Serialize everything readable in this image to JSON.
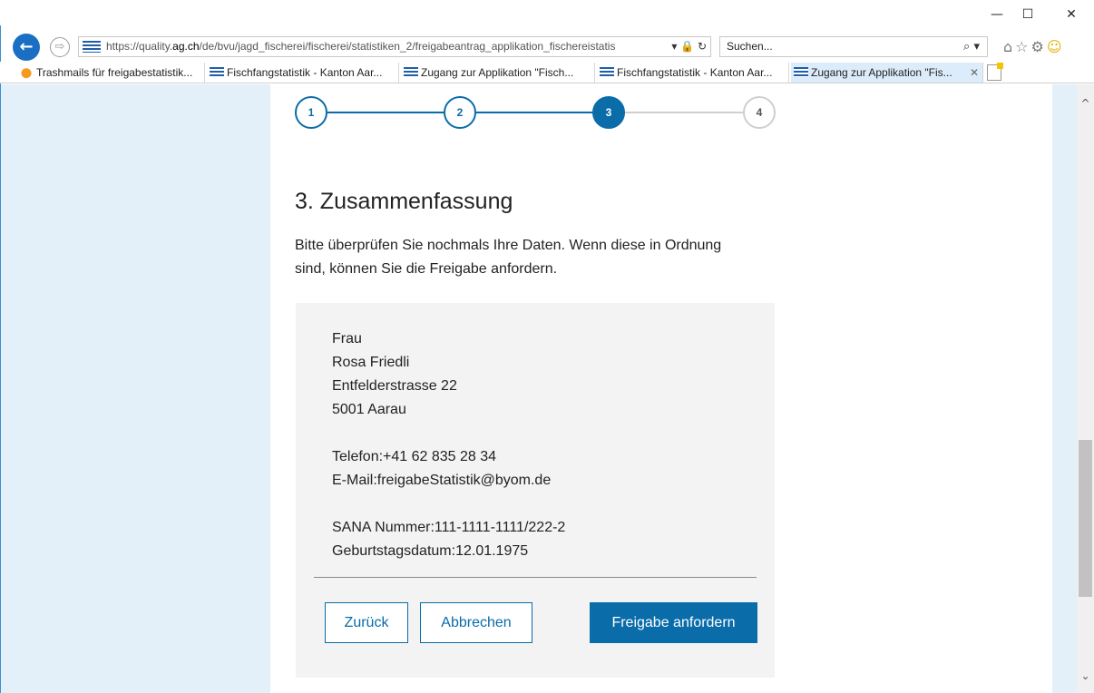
{
  "window": {
    "minimize": "—",
    "maximize": "☐",
    "close": "✕"
  },
  "address_bar": {
    "back_icon": "arrow-left-icon",
    "url_scheme": "https://quality.",
    "url_host": "ag.ch",
    "url_path": "/de/bvu/jagd_fischerei/fischerei/statistiken_2/freigabeantrag_applikation_fischereistatis",
    "controls": "▾ 🔒 ↻",
    "search_placeholder": "Suchen...",
    "search_icon": "⌕ ▾"
  },
  "toolbar": {
    "home_icon": "⌂",
    "star_icon": "☆",
    "gear_icon": "⚙",
    "smiley_icon": "☺"
  },
  "tabs": [
    {
      "label": "Trashmails für freigabestatistik...",
      "icon": "fox-icon"
    },
    {
      "label": "Fischfangstatistik - Kanton Aar...",
      "icon": "aargau-icon"
    },
    {
      "label": "Zugang zur Applikation \"Fisch...",
      "icon": "aargau-icon"
    },
    {
      "label": "Fischfangstatistik - Kanton Aar...",
      "icon": "aargau-icon"
    },
    {
      "label": "Zugang zur Applikation \"Fis...",
      "icon": "aargau-icon",
      "active": true
    }
  ],
  "tab_close": "✕",
  "stepper": {
    "steps": [
      "1",
      "2",
      "3",
      "4"
    ],
    "current": 3
  },
  "page": {
    "title": "3. Zusammenfassung",
    "intro": "Bitte überprüfen Sie nochmals Ihre Daten. Wenn diese in Ordnung sind, können Sie die Freigabe anfordern."
  },
  "summary": {
    "salutation": "Frau",
    "name": "Rosa Friedli",
    "street": "Entfelderstrasse 22",
    "city": "5001 Aarau",
    "phone": "Telefon:+41 62 835 28 34",
    "email": "E-Mail:freigabeStatistik@byom.de",
    "sana": "SANA Nummer:111-1111-1111/222-2",
    "birthdate": "Geburtstagsdatum:12.01.1975"
  },
  "buttons": {
    "back": "Zurück",
    "cancel": "Abbrechen",
    "submit": "Freigabe anfordern"
  },
  "scrollbar": {
    "up": "^",
    "down": "⌄"
  },
  "colors": {
    "accent": "#0a6ca9",
    "side_background": "#e4f0f9",
    "summary_background": "#f3f3f3"
  }
}
